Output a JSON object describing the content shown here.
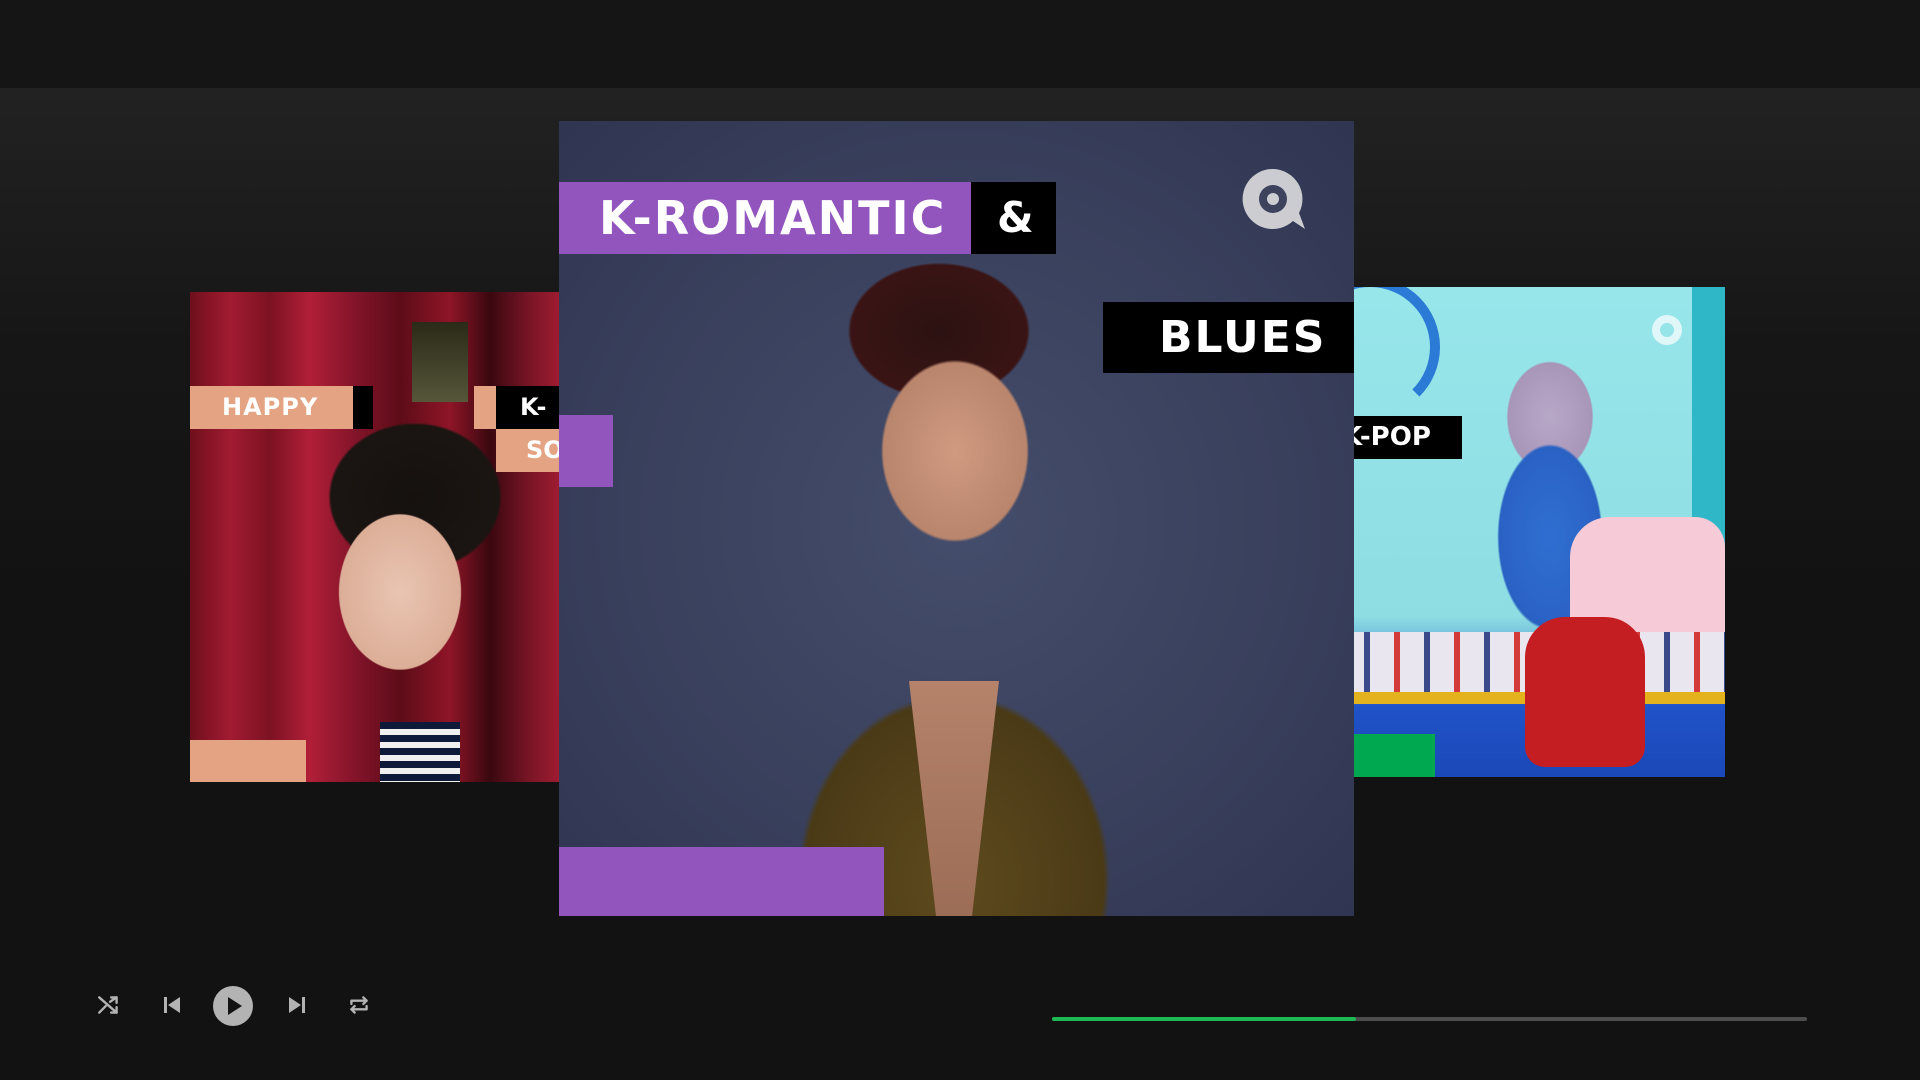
{
  "colors": {
    "background": "#121212",
    "accent_green": "#1db954",
    "kromantic_purple": "#9155bd",
    "happy_peach": "#e4a483",
    "kpop_green": "#00a84f",
    "icon_gray": "#b3b3b3"
  },
  "carousel": {
    "left_card": {
      "labels": [
        "HAPPY",
        "K-",
        "SO"
      ]
    },
    "center_card": {
      "labels": [
        "K-ROMANTIC",
        "&",
        "BLUES"
      ],
      "logo_icon": "playlist-brand-logo-icon"
    },
    "right_card": {
      "labels": [
        "K-POP"
      ],
      "logo_icon": "playlist-brand-logo-icon"
    }
  },
  "player": {
    "icons": {
      "shuffle": "shuffle-icon",
      "previous": "skip-previous-icon",
      "play": "play-icon",
      "next": "skip-next-icon",
      "repeat": "repeat-icon"
    },
    "progress_fraction": 0.403
  }
}
